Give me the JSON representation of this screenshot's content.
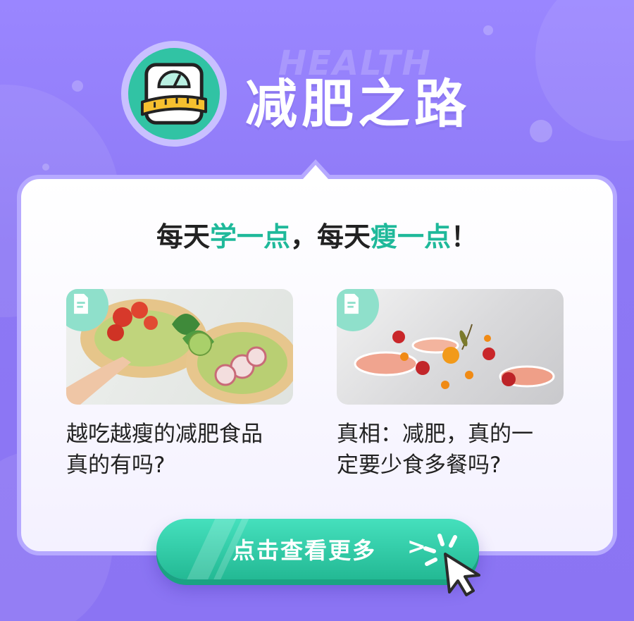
{
  "header": {
    "watermark": "HEALTH",
    "title": "减肥之路",
    "logo_icon": "weighing-scale-tape-icon"
  },
  "tagline": {
    "part1": "每天",
    "highlight1": "学一点",
    "part2": "，每天",
    "highlight2": "瘦一点",
    "part3": "！"
  },
  "articles": [
    {
      "title_line1": "越吃越瘦的减肥食品",
      "title_line2": "真的有吗?",
      "icon": "document-icon",
      "image": "avocado-toast-photo"
    },
    {
      "title_line1": "真相：减肥，真的一",
      "title_line2": "定要少食多餐吗?",
      "icon": "document-icon",
      "image": "fruit-plate-photo"
    }
  ],
  "cta": {
    "label": "点击查看更多",
    "arrow": ">",
    "icon": "pointer-click-icon"
  },
  "colors": {
    "background": "#8d78f5",
    "accent": "#1fb99a",
    "button": "#2bc7a2",
    "card_border": "#b6a9ff"
  }
}
